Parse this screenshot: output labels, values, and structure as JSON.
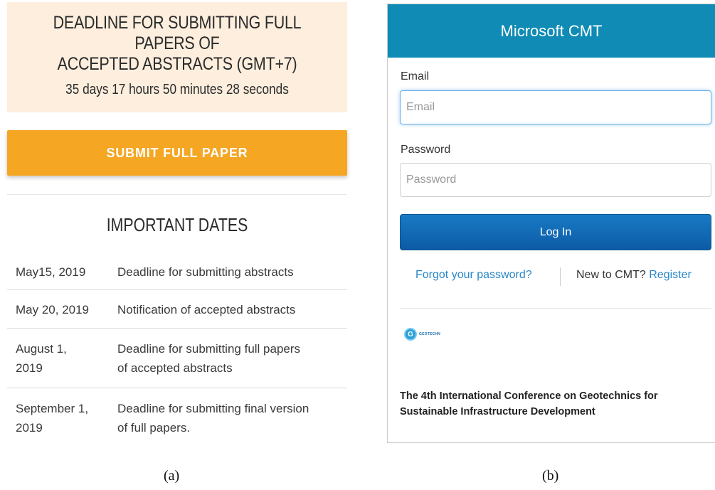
{
  "panel_a": {
    "deadline_title_line1": "DEADLINE FOR SUBMITTING FULL PAPERS OF",
    "deadline_title_line2": "ACCEPTED ABSTRACTS (GMT+7)",
    "countdown": "35 days 17 hours 50 minutes 28 seconds",
    "submit_label": "SUBMIT FULL PAPER",
    "dates_heading": "IMPORTANT DATES",
    "dates": [
      {
        "date": "May15, 2019",
        "event": "Deadline for submitting abstracts"
      },
      {
        "date": "May 20, 2019",
        "event": "Notification of accepted abstracts"
      },
      {
        "date_line1": "August 1,",
        "date_line2": "2019",
        "event_line1": "Deadline for submitting full papers",
        "event_line2": "of accepted abstracts"
      },
      {
        "date_line1": "September 1,",
        "date_line2": "2019",
        "event_line1": "Deadline for submitting final version",
        "event_line2": "of full papers."
      }
    ],
    "caption": "(a)"
  },
  "panel_b": {
    "header_title": "Microsoft CMT",
    "email_label": "Email",
    "email_placeholder": "Email",
    "password_label": "Password",
    "password_placeholder": "Password",
    "login_label": "Log In",
    "forgot_link": "Forgot your password?",
    "new_to_text": "New to CMT?",
    "register_link": "Register",
    "logo_word": "GEOTECHN",
    "conference_title_line1": "The 4th International Conference on Geotechnics for",
    "conference_title_line2": "Sustainable Infrastructure Development",
    "caption": "(b)"
  },
  "colors": {
    "deadline_bg": "#fdeedd",
    "submit_button": "#f5a623",
    "cmt_header": "#0f8bb5",
    "login_button": "#0b5ba6",
    "link": "#2a86c8"
  }
}
